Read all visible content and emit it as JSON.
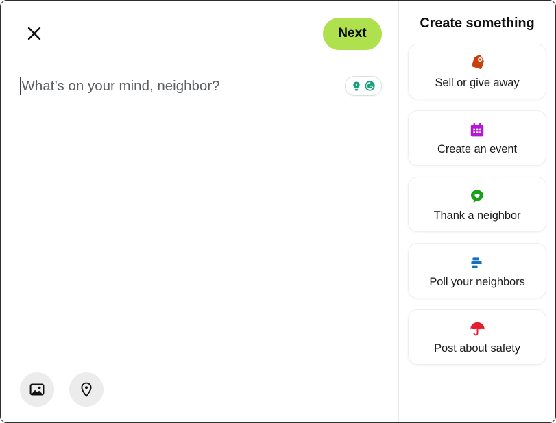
{
  "composer": {
    "close_icon": "close-icon",
    "next_label": "Next",
    "placeholder": "What’s on your mind, neighbor?",
    "text_value": "",
    "assist": {
      "name": "grammarly-assist-pill",
      "icons": [
        "lightbulb-suggestion-icon",
        "grammarly-logo-icon"
      ],
      "color": "#15a07e"
    },
    "attachments": [
      {
        "name": "add-photo-button",
        "icon": "image-icon"
      },
      {
        "name": "add-location-button",
        "icon": "location-pin-icon"
      }
    ],
    "accent_color": "#aee14d"
  },
  "sidebar": {
    "title": "Create something",
    "cards": [
      {
        "label": "Sell or give away",
        "icon": "price-tag-icon",
        "color": "#c8400c"
      },
      {
        "label": "Create an event",
        "icon": "calendar-icon",
        "color": "#b417d6"
      },
      {
        "label": "Thank a neighbor",
        "icon": "heart-bubble-icon",
        "color": "#19a019"
      },
      {
        "label": "Poll your neighbors",
        "icon": "poll-bars-icon",
        "color": "#1571bd"
      },
      {
        "label": "Post about safety",
        "icon": "umbrella-icon",
        "color": "#e31e30"
      }
    ]
  }
}
